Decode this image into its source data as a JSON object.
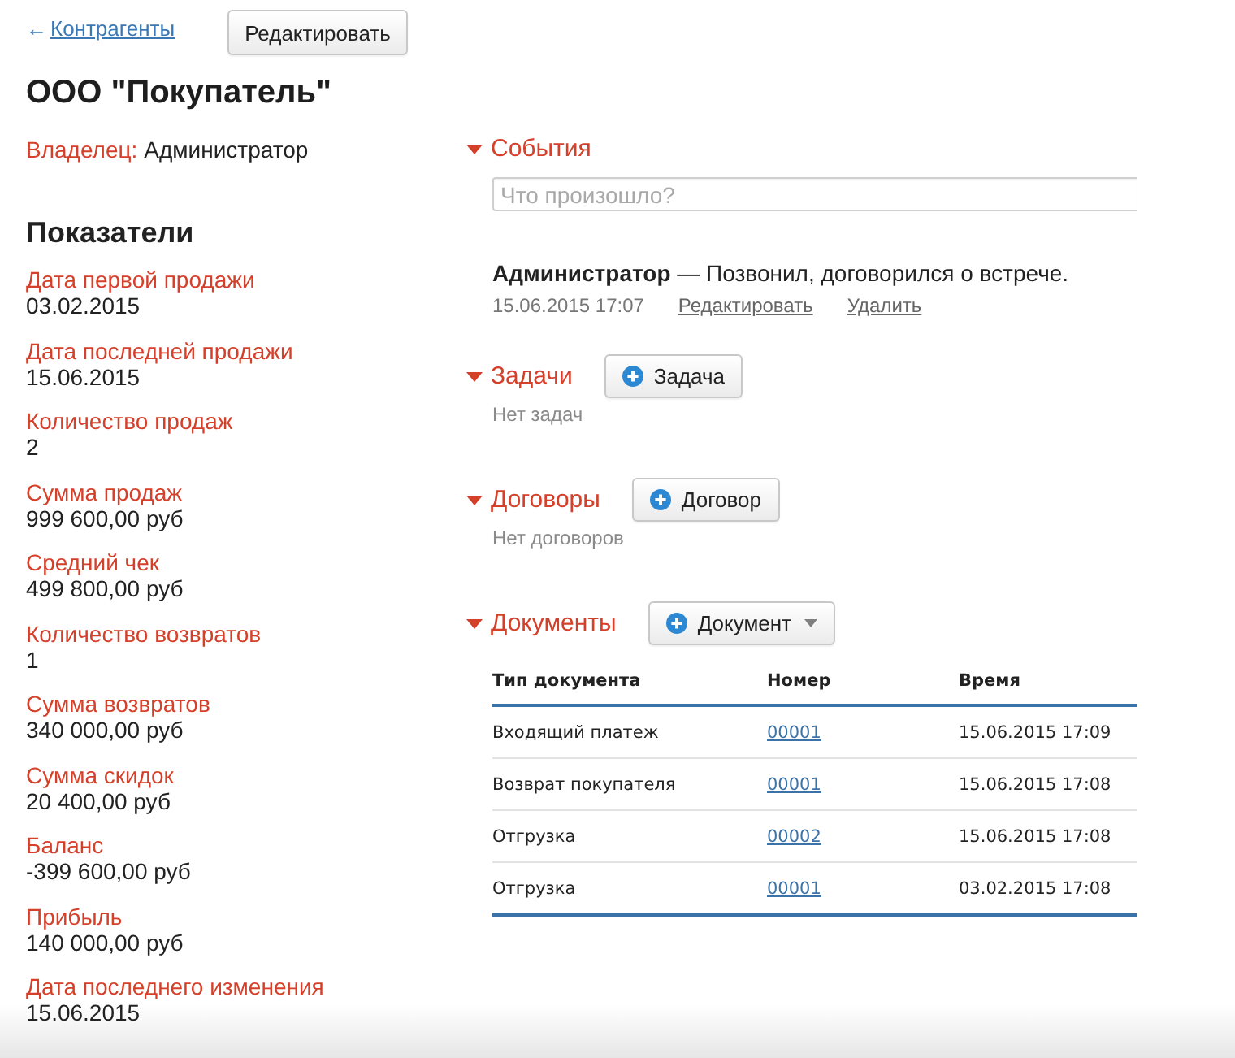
{
  "header": {
    "back_link": {
      "arrow": "←",
      "label": "Контрагенты"
    },
    "edit_button": "Редактировать"
  },
  "title": "ООО \"Покупатель\"",
  "owner": {
    "label": "Владелец:",
    "value": "Администратор"
  },
  "metrics": {
    "title": "Показатели",
    "items": [
      {
        "label": "Дата первой продажи",
        "value": "03.02.2015"
      },
      {
        "label": "Дата последней продажи",
        "value": "15.06.2015"
      },
      {
        "label": "Количество продаж",
        "value": "2"
      },
      {
        "label": "Сумма продаж",
        "value": "999 600,00 руб"
      },
      {
        "label": "Средний чек",
        "value": "499 800,00 руб"
      },
      {
        "label": "Количество возвратов",
        "value": "1"
      },
      {
        "label": "Сумма возвратов",
        "value": "340 000,00 руб"
      },
      {
        "label": "Сумма скидок",
        "value": "20 400,00 руб"
      },
      {
        "label": "Баланс",
        "value": "-399 600,00 руб"
      },
      {
        "label": "Прибыль",
        "value": "140 000,00 руб"
      },
      {
        "label": "Дата последнего изменения",
        "value": "15.06.2015"
      }
    ]
  },
  "sections": [
    {
      "kind": "events",
      "title": "События",
      "expanded": true,
      "input": {
        "placeholder": "Что произошло?"
      },
      "events": [
        {
          "text": "**Администратор** — Позвонил, договорился о встрече.",
          "time": "15.06.2015 17:07",
          "actions": [
            "Редактировать",
            "Удалить"
          ]
        }
      ]
    },
    {
      "kind": "list",
      "title": "Задачи",
      "expanded": true,
      "add_button": {
        "label": "Задача",
        "dropdown": false
      },
      "empty_text": "Нет задач"
    },
    {
      "kind": "list",
      "title": "Договоры",
      "expanded": true,
      "add_button": {
        "label": "Договор",
        "dropdown": false
      },
      "empty_text": "Нет договоров"
    },
    {
      "kind": "table",
      "title": "Документы",
      "expanded": true,
      "add_button": {
        "label": "Документ",
        "dropdown": true
      },
      "table": {
        "columns": [
          {
            "label": "Тип документа",
            "kind": "text"
          },
          {
            "label": "Номер",
            "kind": "link"
          },
          {
            "label": "Время",
            "kind": "text"
          }
        ],
        "rows": [
          [
            "Входящий платеж",
            "00001",
            "15.06.2015 17:09"
          ],
          [
            "Возврат покупателя",
            "00001",
            "15.06.2015 17:08"
          ],
          [
            "Отгрузка",
            "00002",
            "15.06.2015 17:08"
          ],
          [
            "Отгрузка",
            "00001",
            "03.02.2015 17:08"
          ]
        ]
      }
    }
  ]
}
